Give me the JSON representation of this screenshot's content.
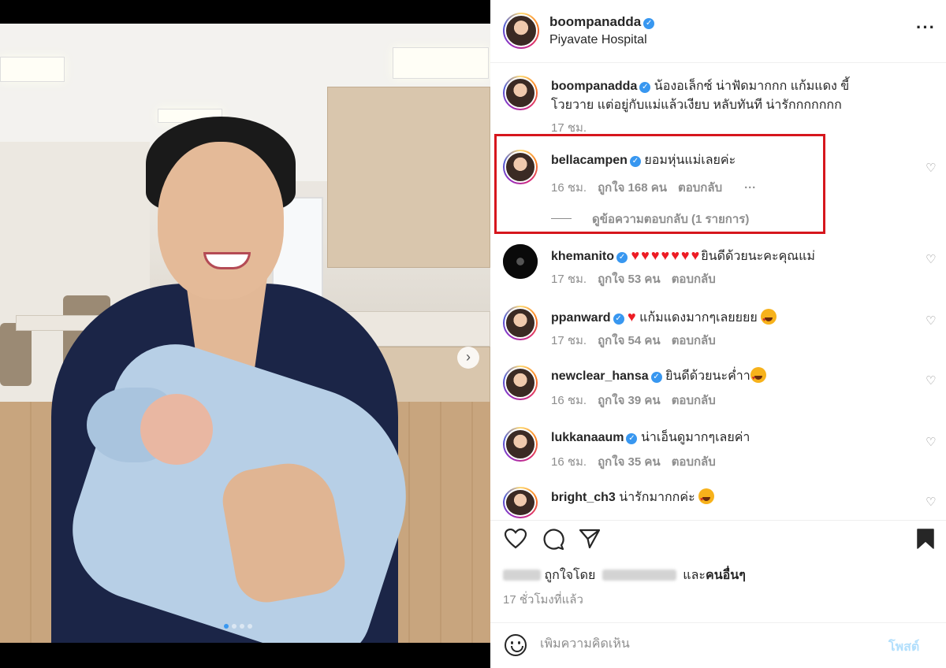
{
  "post": {
    "username": "boompanadda",
    "location": "Piyavate Hospital",
    "more_label": "···"
  },
  "photo": {
    "carousel_count": 4,
    "active_index": 0,
    "next_label": "›"
  },
  "caption": {
    "username": "boompanadda",
    "text_line1": "น้องอเล็กซ์ น่าฟัดมากกก แก้มแดง ขี้",
    "text_line2": "โวยวาย แต่อยู่กับแม่แล้วเงียบ หลับทันที น่ารักกกกกกก",
    "time": "17 ชม."
  },
  "comments": [
    {
      "username": "bellacampen",
      "verified": true,
      "text": "ยอมหุ่นแม่เลยค่ะ",
      "time": "16 ชม.",
      "likes": "ถูกใจ 168 คน",
      "reply": "ตอบกลับ",
      "more": "···",
      "view_replies": "ดูข้อความตอบกลับ (1 รายการ)"
    },
    {
      "username": "khemanito",
      "verified": true,
      "hearts": "♥♥♥♥♥♥♥",
      "text": "ยินดีด้วยนะคะคุณแม่",
      "time": "17 ชม.",
      "likes": "ถูกใจ 53 คน",
      "reply": "ตอบกลับ"
    },
    {
      "username": "ppanward",
      "verified": true,
      "hearts": "♥",
      "text": "แก้มแดงมากๆเลยยยย",
      "time": "17 ชม.",
      "likes": "ถูกใจ 54 คน",
      "reply": "ตอบกลับ"
    },
    {
      "username": "newclear_hansa",
      "verified": true,
      "text": "ยินดีด้วยนะค่ำา",
      "time": "16 ชม.",
      "likes": "ถูกใจ 39 คน",
      "reply": "ตอบกลับ"
    },
    {
      "username": "lukkanaaum",
      "verified": true,
      "text": "น่าเอ็นดูมากๆเลยค่า",
      "time": "16 ชม.",
      "likes": "ถูกใจ 35 คน",
      "reply": "ตอบกลับ"
    },
    {
      "username": "bright_ch3",
      "verified": false,
      "text": "น่ารักมากกค่ะ"
    }
  ],
  "actions": {
    "like_icon": "heart-outline-icon",
    "comment_icon": "comment-bubble-icon",
    "share_icon": "paper-plane-icon",
    "save_icon": "bookmark-icon"
  },
  "likes": {
    "liked_by": "ถูกใจโดย",
    "and_others_prefix": "และ",
    "and_others": "คนอื่นๆ"
  },
  "time_ago": "17 ชั่วโมงที่แล้ว",
  "comment_box": {
    "placeholder": "เพิ่มความคิดเห็น",
    "post_label": "โพสต์"
  },
  "colors": {
    "highlight": "#d6161d",
    "verified": "#3897f0",
    "heart_red": "#ed1c24",
    "muted": "#8e8e8e"
  }
}
